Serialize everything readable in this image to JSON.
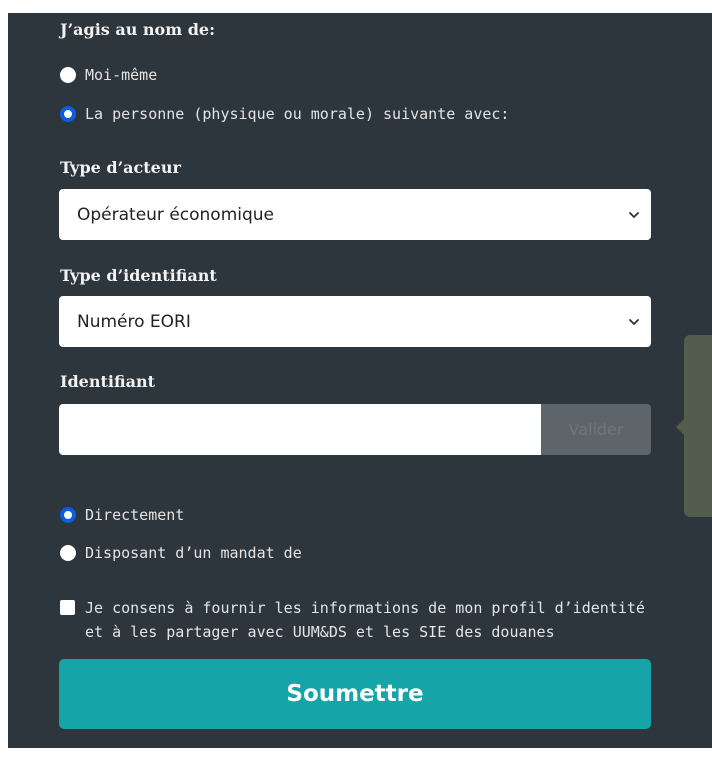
{
  "form": {
    "on_behalf_heading": "J’agis au nom de:",
    "options_behalf": [
      {
        "label": "Moi-même",
        "checked": false
      },
      {
        "label": "La personne (physique ou morale) suivante avec:",
        "checked": true
      }
    ],
    "actor_type": {
      "label": "Type d’acteur",
      "value": "Opérateur économique"
    },
    "identifier_type": {
      "label": "Type d’identifiant",
      "value": "Numéro EORI"
    },
    "identifier": {
      "label": "Identifiant",
      "value": "",
      "validate_label": "Valider"
    },
    "options_mandate": [
      {
        "label": "Directement",
        "checked": true
      },
      {
        "label": "Disposant d’un mandat de",
        "checked": false
      }
    ],
    "consent": {
      "lines": [
        "Je consens à fournir les informations de mon profil d’identité",
        "et à les partager avec UUM&DS et les SIE des douanes"
      ],
      "checked": false
    },
    "submit_label": "Soumettre"
  },
  "colors": {
    "panel_bg": "#2d353d",
    "radio_accent": "#0a5fe0",
    "submit_bg": "#15a5a9",
    "tooltip_bg": "#545c4e"
  }
}
